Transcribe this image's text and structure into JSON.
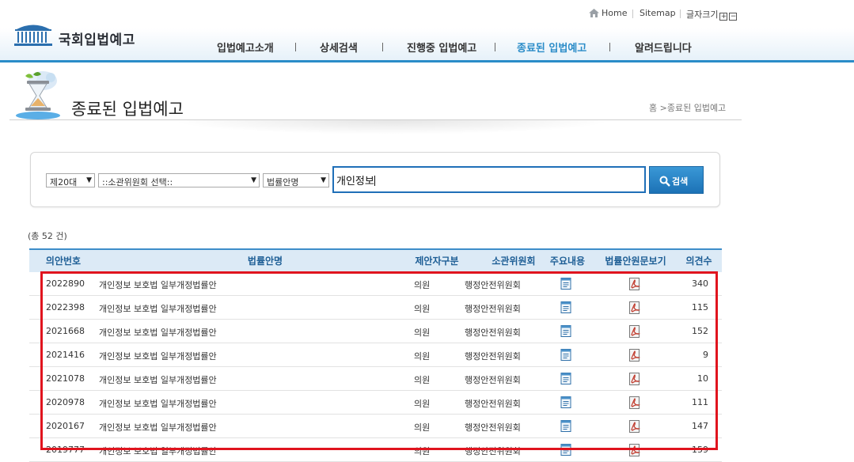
{
  "header": {
    "logo_text": "국회입법예고",
    "util": {
      "home": "Home",
      "sitemap": "Sitemap",
      "font_size": "글자크기",
      "font_plus": "+",
      "font_minus": "−"
    },
    "nav": [
      {
        "label": "입법예고소개",
        "active": false
      },
      {
        "label": "상세검색",
        "active": false
      },
      {
        "label": "진행중 입법예고",
        "active": false
      },
      {
        "label": "종료된 입법예고",
        "active": true
      },
      {
        "label": "알려드립니다",
        "active": false
      }
    ],
    "accent_color": "#2a8cc8"
  },
  "page": {
    "title": "종료된 입법예고",
    "breadcrumb": {
      "home": "홈",
      "sep": ">",
      "current": "종료된 입법예고"
    }
  },
  "search": {
    "age_select": "제20대",
    "committee_select": "::소관위원회 선택::",
    "field_select": "법률안명",
    "query": "개인정보",
    "button_label": "검색"
  },
  "results": {
    "total_text": "(총 52 건)",
    "columns": [
      "의안번호",
      "법률안명",
      "제안자구분",
      "소관위원회",
      "주요내용",
      "법률안원문보기",
      "의견수"
    ],
    "rows": [
      {
        "no": "2022890",
        "name": "개인정보 보호법 일부개정법률안",
        "proposer": "의원",
        "committee": "행정안전위원회",
        "opinions": "340"
      },
      {
        "no": "2022398",
        "name": "개인정보 보호법 일부개정법률안",
        "proposer": "의원",
        "committee": "행정안전위원회",
        "opinions": "115"
      },
      {
        "no": "2021668",
        "name": "개인정보 보호법 일부개정법률안",
        "proposer": "의원",
        "committee": "행정안전위원회",
        "opinions": "152"
      },
      {
        "no": "2021416",
        "name": "개인정보 보호법 일부개정법률안",
        "proposer": "의원",
        "committee": "행정안전위원회",
        "opinions": "9"
      },
      {
        "no": "2021078",
        "name": "개인정보 보호법 일부개정법률안",
        "proposer": "의원",
        "committee": "행정안전위원회",
        "opinions": "10"
      },
      {
        "no": "2020978",
        "name": "개인정보 보호법 일부개정법률안",
        "proposer": "의원",
        "committee": "행정안전위원회",
        "opinions": "111"
      },
      {
        "no": "2020167",
        "name": "개인정보 보호법 일부개정법률안",
        "proposer": "의원",
        "committee": "행정안전위원회",
        "opinions": "147"
      },
      {
        "no": "2019777",
        "name": "개인정보 보호법 일부개정법률안",
        "proposer": "의원",
        "committee": "행정안전위원회",
        "opinions": "159"
      }
    ],
    "icons": {
      "summary": "document-icon",
      "original": "pdf-icon"
    },
    "highlight_color": "#e0141e"
  }
}
